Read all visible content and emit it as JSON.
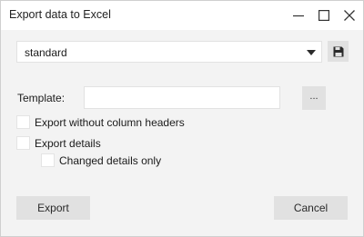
{
  "window": {
    "title": "Export data to Excel"
  },
  "preset": {
    "selected": "standard"
  },
  "template": {
    "label": "Template:",
    "value": "",
    "browse_label": "..."
  },
  "options": {
    "without_headers": "Export without column headers",
    "export_details": "Export details",
    "changed_details_only": "Changed details only"
  },
  "buttons": {
    "export": "Export",
    "cancel": "Cancel"
  },
  "icons": {
    "minimize": "minimize-icon",
    "maximize": "maximize-icon",
    "close": "close-icon",
    "dropdown": "chevron-down-icon",
    "save": "save-icon"
  }
}
